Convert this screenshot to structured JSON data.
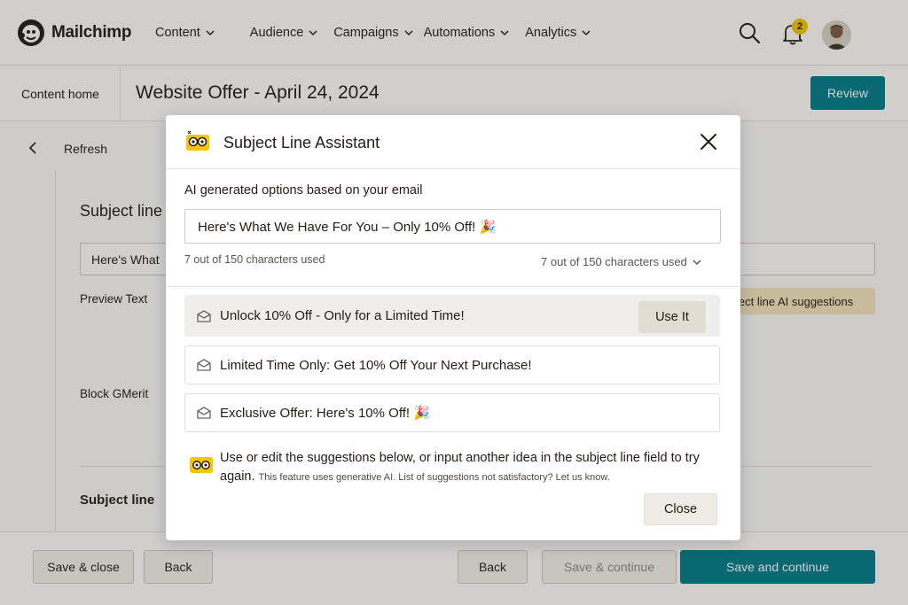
{
  "app": {
    "brand_name": "Mailchimp"
  },
  "nav": {
    "items": [
      {
        "label": "Content"
      },
      {
        "label": "Audience"
      },
      {
        "label": "Campaigns"
      },
      {
        "label": "Automations"
      },
      {
        "label": "Analytics"
      }
    ],
    "notification_count": "2",
    "icons": {
      "search": "search-icon",
      "bell": "bell-icon",
      "chevron": "chevron-down-icon"
    }
  },
  "subheader": {
    "content_home": "Content home",
    "page_title": "Website Offer - April 24, 2024",
    "review_label": "Review"
  },
  "editor": {
    "refresh_label": "Refresh",
    "subject_heading": "Subject line",
    "subject_value": "Here's What",
    "preview_text_label": "Preview Text",
    "ai_suggestions_chip": "ject line AI suggestions",
    "block_label": "Block GMerit",
    "subject_line_bold": "Subject line"
  },
  "footer": {
    "save_close": "Save & close",
    "back_left": "Back",
    "back_right": "Back",
    "save_continue_ghost": "Save & continue",
    "save_and_continue": "Save and continue"
  },
  "modal": {
    "title": "Subject Line Assistant",
    "subtitle": "AI generated options based on your email",
    "input_value": "Here's What We Have For You – Only 10% Off! 🎉",
    "count_left": "7 out of 150 characters used",
    "count_right": "7 out of 150 characters used",
    "suggestions": [
      {
        "text": "Unlock 10% Off - Only for a Limited Time!"
      },
      {
        "text": "Limited Time Only: Get 10% Off Your Next Purchase!"
      },
      {
        "text": "Exclusive Offer: Here's 10% Off! 🎉"
      }
    ],
    "use_it_label": "Use It",
    "footer_main": "Use or edit the suggestions below, or input another idea in the subject line field to try again.",
    "footer_small": "This feature uses generative AI. List of suggestions not satisfactory? Let us know.",
    "close_label": "Close"
  },
  "colors": {
    "accent": "#007c89",
    "badge": "#f7c600",
    "chip": "#f4e6bf"
  }
}
